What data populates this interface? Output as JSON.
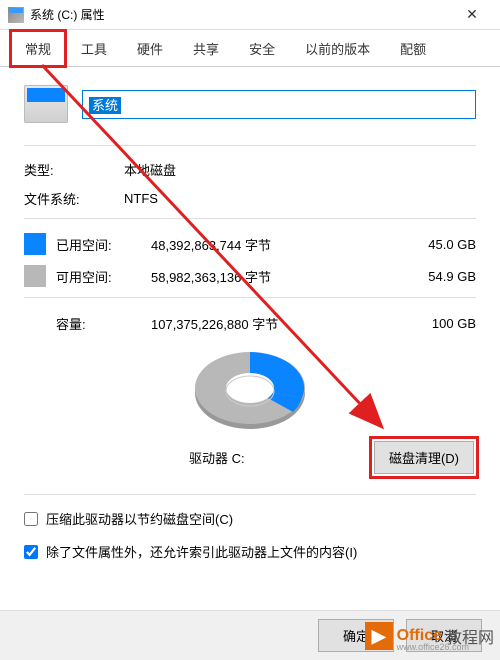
{
  "titlebar": {
    "title": "系统 (C:) 属性"
  },
  "tabs": {
    "general": "常规",
    "tools": "工具",
    "hardware": "硬件",
    "sharing": "共享",
    "security": "安全",
    "previous": "以前的版本",
    "quota": "配额"
  },
  "drive": {
    "name": "系统"
  },
  "info": {
    "type_label": "类型:",
    "type_value": "本地磁盘",
    "fs_label": "文件系统:",
    "fs_value": "NTFS"
  },
  "space": {
    "used_label": "已用空间:",
    "used_bytes": "48,392,863,744 字节",
    "used_size": "45.0 GB",
    "free_label": "可用空间:",
    "free_bytes": "58,982,363,136 字节",
    "free_size": "54.9 GB",
    "capacity_label": "容量:",
    "capacity_bytes": "107,375,226,880 字节",
    "capacity_size": "100 GB"
  },
  "drive_label": "驱动器 C:",
  "cleanup_btn": "磁盘清理(D)",
  "options": {
    "compress": "压缩此驱动器以节约磁盘空间(C)",
    "index": "除了文件属性外，还允许索引此驱动器上文件的内容(I)"
  },
  "buttons": {
    "ok": "确定",
    "cancel": "取消"
  },
  "watermark": {
    "text1": "Office",
    "text2": "教程网",
    "url": "www.office26.com"
  },
  "chart_data": {
    "type": "pie",
    "title": "驱动器 C:",
    "series": [
      {
        "name": "已用空间",
        "value": 45.0,
        "color": "#0a84ff"
      },
      {
        "name": "可用空间",
        "value": 54.9,
        "color": "#b8b8b8"
      }
    ],
    "total": 100
  }
}
